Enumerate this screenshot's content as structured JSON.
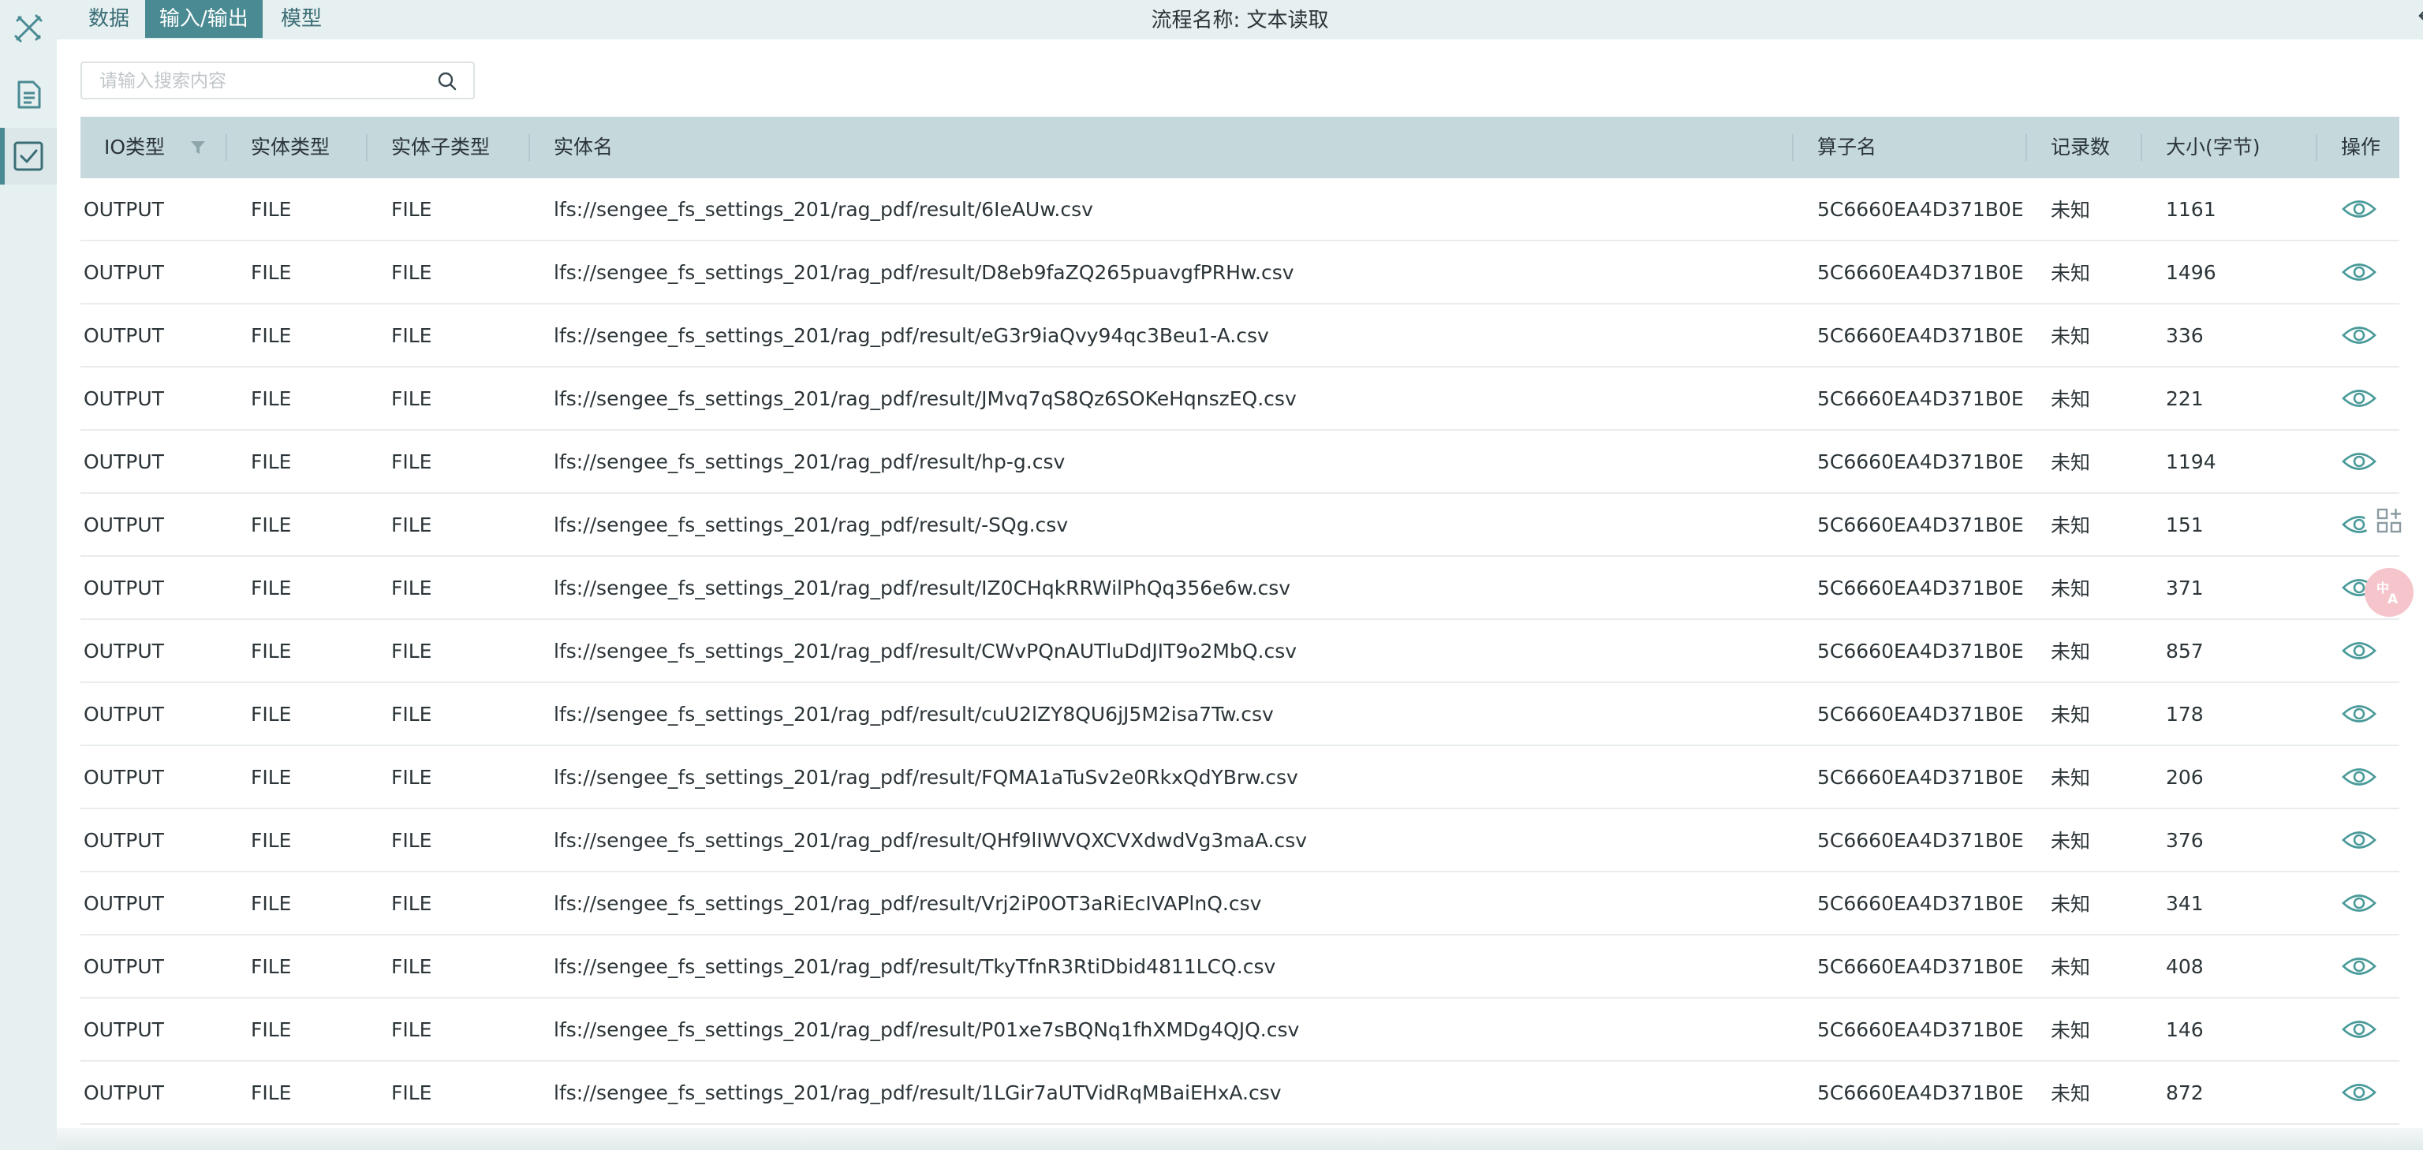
{
  "header": {
    "tabs": [
      {
        "label": "数据"
      },
      {
        "label": "输入/输出",
        "active": true
      },
      {
        "label": "模型"
      }
    ],
    "flow_title": "流程名称: 文本读取"
  },
  "sidebar": {
    "items": [
      {
        "icon": "tools-icon"
      },
      {
        "icon": "document-icon"
      },
      {
        "icon": "checkbox-icon",
        "active": true
      }
    ]
  },
  "search": {
    "placeholder": "请输入搜索内容",
    "value": ""
  },
  "table": {
    "columns": [
      "IO类型",
      "实体类型",
      "实体子类型",
      "实体名",
      "算子名",
      "记录数",
      "大小(字节)",
      "操作"
    ],
    "rows": [
      [
        "OUTPUT",
        "FILE",
        "FILE",
        "lfs://sengee_fs_settings_201/rag_pdf/result/6IeAUw.csv",
        "5C6660EA4D371B0E",
        "未知",
        "1161"
      ],
      [
        "OUTPUT",
        "FILE",
        "FILE",
        "lfs://sengee_fs_settings_201/rag_pdf/result/D8eb9faZQ265puavgfPRHw.csv",
        "5C6660EA4D371B0E",
        "未知",
        "1496"
      ],
      [
        "OUTPUT",
        "FILE",
        "FILE",
        "lfs://sengee_fs_settings_201/rag_pdf/result/eG3r9iaQvy94qc3Beu1-A.csv",
        "5C6660EA4D371B0E",
        "未知",
        "336"
      ],
      [
        "OUTPUT",
        "FILE",
        "FILE",
        "lfs://sengee_fs_settings_201/rag_pdf/result/JMvq7qS8Qz6SOKeHqnszEQ.csv",
        "5C6660EA4D371B0E",
        "未知",
        "221"
      ],
      [
        "OUTPUT",
        "FILE",
        "FILE",
        "lfs://sengee_fs_settings_201/rag_pdf/result/hp-g.csv",
        "5C6660EA4D371B0E",
        "未知",
        "1194"
      ],
      [
        "OUTPUT",
        "FILE",
        "FILE",
        "lfs://sengee_fs_settings_201/rag_pdf/result/-SQg.csv",
        "5C6660EA4D371B0E",
        "未知",
        "151"
      ],
      [
        "OUTPUT",
        "FILE",
        "FILE",
        "lfs://sengee_fs_settings_201/rag_pdf/result/IZ0CHqkRRWilPhQq356e6w.csv",
        "5C6660EA4D371B0E",
        "未知",
        "371"
      ],
      [
        "OUTPUT",
        "FILE",
        "FILE",
        "lfs://sengee_fs_settings_201/rag_pdf/result/CWvPQnAUTluDdJIT9o2MbQ.csv",
        "5C6660EA4D371B0E",
        "未知",
        "857"
      ],
      [
        "OUTPUT",
        "FILE",
        "FILE",
        "lfs://sengee_fs_settings_201/rag_pdf/result/cuU2lZY8QU6jJ5M2isa7Tw.csv",
        "5C6660EA4D371B0E",
        "未知",
        "178"
      ],
      [
        "OUTPUT",
        "FILE",
        "FILE",
        "lfs://sengee_fs_settings_201/rag_pdf/result/FQMA1aTuSv2e0RkxQdYBrw.csv",
        "5C6660EA4D371B0E",
        "未知",
        "206"
      ],
      [
        "OUTPUT",
        "FILE",
        "FILE",
        "lfs://sengee_fs_settings_201/rag_pdf/result/QHf9lIWVQXCVXdwdVg3maA.csv",
        "5C6660EA4D371B0E",
        "未知",
        "376"
      ],
      [
        "OUTPUT",
        "FILE",
        "FILE",
        "lfs://sengee_fs_settings_201/rag_pdf/result/Vrj2iP0OT3aRiEcIVAPlnQ.csv",
        "5C6660EA4D371B0E",
        "未知",
        "341"
      ],
      [
        "OUTPUT",
        "FILE",
        "FILE",
        "lfs://sengee_fs_settings_201/rag_pdf/result/TkyTfnR3RtiDbid4811LCQ.csv",
        "5C6660EA4D371B0E",
        "未知",
        "408"
      ],
      [
        "OUTPUT",
        "FILE",
        "FILE",
        "lfs://sengee_fs_settings_201/rag_pdf/result/P01xe7sBQNq1fhXMDg4QJQ.csv",
        "5C6660EA4D371B0E",
        "未知",
        "146"
      ],
      [
        "OUTPUT",
        "FILE",
        "FILE",
        "lfs://sengee_fs_settings_201/rag_pdf/result/1LGir7aUTVidRqMBaiEHxA.csv",
        "5C6660EA4D371B0E",
        "未知",
        "872"
      ]
    ],
    "row_action_icon": "eye-icon"
  },
  "floating": {
    "icons": [
      "grid-add-icon",
      "translate-icon"
    ]
  },
  "colors": {
    "accent": "#4a8a93",
    "header_bg": "#c5d9dc",
    "page_bg": "#e6f0f1",
    "eye_icon": "#4a9a9a"
  }
}
